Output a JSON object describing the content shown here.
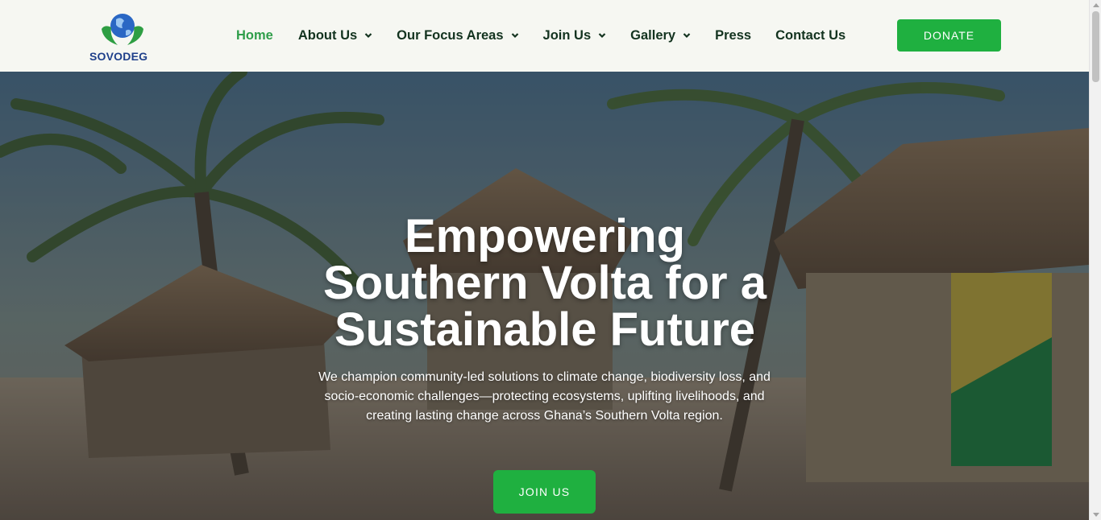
{
  "brand": {
    "name": "SOVODEG",
    "logo_icon": "globe-hands-icon"
  },
  "nav": {
    "items": [
      {
        "label": "Home",
        "active": true,
        "dropdown": false
      },
      {
        "label": "About Us",
        "active": false,
        "dropdown": true
      },
      {
        "label": "Our Focus Areas",
        "active": false,
        "dropdown": true
      },
      {
        "label": "Join Us",
        "active": false,
        "dropdown": true
      },
      {
        "label": "Gallery",
        "active": false,
        "dropdown": true
      },
      {
        "label": "Press",
        "active": false,
        "dropdown": false
      },
      {
        "label": "Contact Us",
        "active": false,
        "dropdown": false
      }
    ],
    "donate_label": "DONATE"
  },
  "hero": {
    "title": "Empowering Southern Volta for a Sustainable Future",
    "subtitle": "We champion community-led solutions to climate change, biodiversity loss, and socio-economic challenges—protecting ecosystems, uplifting livelihoods, and creating lasting change across Ghana’s Southern Volta region.",
    "cta_label": "JOIN US",
    "background": "palm-trees-and-thatched-huts-photo"
  },
  "colors": {
    "accent": "#1fb040",
    "nav_text": "#13331f",
    "active_nav": "#2f9e4a",
    "header_bg": "#f6f7f2",
    "brand_blue": "#1e3f8a"
  }
}
